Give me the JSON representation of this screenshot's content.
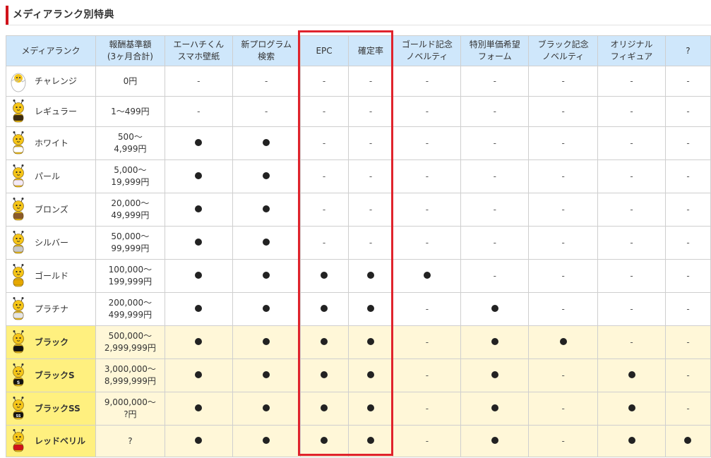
{
  "section_title": "メディアランク別特典",
  "colors": {
    "header_bg": "#cfe7fb",
    "black_tier_rank_bg": "#fff07f",
    "black_tier_row_bg": "#fff7d8",
    "highlight": "#e0232c",
    "accent_bar": "#d0121b"
  },
  "columns": [
    {
      "label": "メディアランク"
    },
    {
      "label": "報酬基準額\n(3ヶ月合計)"
    },
    {
      "label": "エーハチくん\nスマホ壁紙"
    },
    {
      "label": "新プログラム\n検索"
    },
    {
      "label": "EPC"
    },
    {
      "label": "確定率"
    },
    {
      "label": "ゴールド記念\nノベルティ"
    },
    {
      "label": "特別単価希望\nフォーム"
    },
    {
      "label": "ブラック記念\nノベルティ"
    },
    {
      "label": "オリジナル\nフィギュア"
    },
    {
      "label": "?"
    }
  ],
  "rows": [
    {
      "name": "チャレンジ",
      "range": "0円",
      "icon": "egg-bee-icon",
      "cells": [
        "-",
        "-",
        "-",
        "-",
        "-",
        "-",
        "-",
        "-",
        "-"
      ]
    },
    {
      "name": "レギュラー",
      "range": "1〜499円",
      "icon": "regular-bee-icon",
      "cells": [
        "-",
        "-",
        "-",
        "-",
        "-",
        "-",
        "-",
        "-",
        "-"
      ]
    },
    {
      "name": "ホワイト",
      "range": "500〜\n4,999円",
      "icon": "white-bee-icon",
      "cells": [
        "●",
        "●",
        "-",
        "-",
        "-",
        "-",
        "-",
        "-",
        "-"
      ]
    },
    {
      "name": "パール",
      "range": "5,000〜\n19,999円",
      "icon": "pearl-bee-icon",
      "cells": [
        "●",
        "●",
        "-",
        "-",
        "-",
        "-",
        "-",
        "-",
        "-"
      ]
    },
    {
      "name": "ブロンズ",
      "range": "20,000〜\n49,999円",
      "icon": "bronze-bee-icon",
      "cells": [
        "●",
        "●",
        "-",
        "-",
        "-",
        "-",
        "-",
        "-",
        "-"
      ]
    },
    {
      "name": "シルバー",
      "range": "50,000〜\n99,999円",
      "icon": "silver-bee-icon",
      "cells": [
        "●",
        "●",
        "-",
        "-",
        "-",
        "-",
        "-",
        "-",
        "-"
      ]
    },
    {
      "name": "ゴールド",
      "range": "100,000〜\n199,999円",
      "icon": "gold-bee-icon",
      "cells": [
        "●",
        "●",
        "●",
        "●",
        "●",
        "-",
        "-",
        "-",
        "-"
      ]
    },
    {
      "name": "プラチナ",
      "range": "200,000〜\n499,999円",
      "icon": "platinum-bee-icon",
      "cells": [
        "●",
        "●",
        "●",
        "●",
        "-",
        "●",
        "-",
        "-",
        "-"
      ]
    },
    {
      "name": "ブラック",
      "range": "500,000〜\n2,999,999円",
      "icon": "black-bee-icon",
      "tier": "black",
      "cells": [
        "●",
        "●",
        "●",
        "●",
        "-",
        "●",
        "●",
        "-",
        "-"
      ]
    },
    {
      "name": "ブラックS",
      "range": "3,000,000〜\n8,999,999円",
      "icon": "black-s-bee-icon",
      "tier": "black",
      "cells": [
        "●",
        "●",
        "●",
        "●",
        "-",
        "●",
        "-",
        "●",
        "-"
      ]
    },
    {
      "name": "ブラックSS",
      "range": "9,000,000〜\n?円",
      "icon": "black-ss-bee-icon",
      "tier": "black",
      "cells": [
        "●",
        "●",
        "●",
        "●",
        "-",
        "●",
        "-",
        "●",
        "-"
      ]
    },
    {
      "name": "レッドベリル",
      "range": "?",
      "icon": "red-beryl-bee-icon",
      "tier": "black",
      "cells": [
        "●",
        "●",
        "●",
        "●",
        "-",
        "●",
        "-",
        "●",
        "●"
      ]
    }
  ]
}
